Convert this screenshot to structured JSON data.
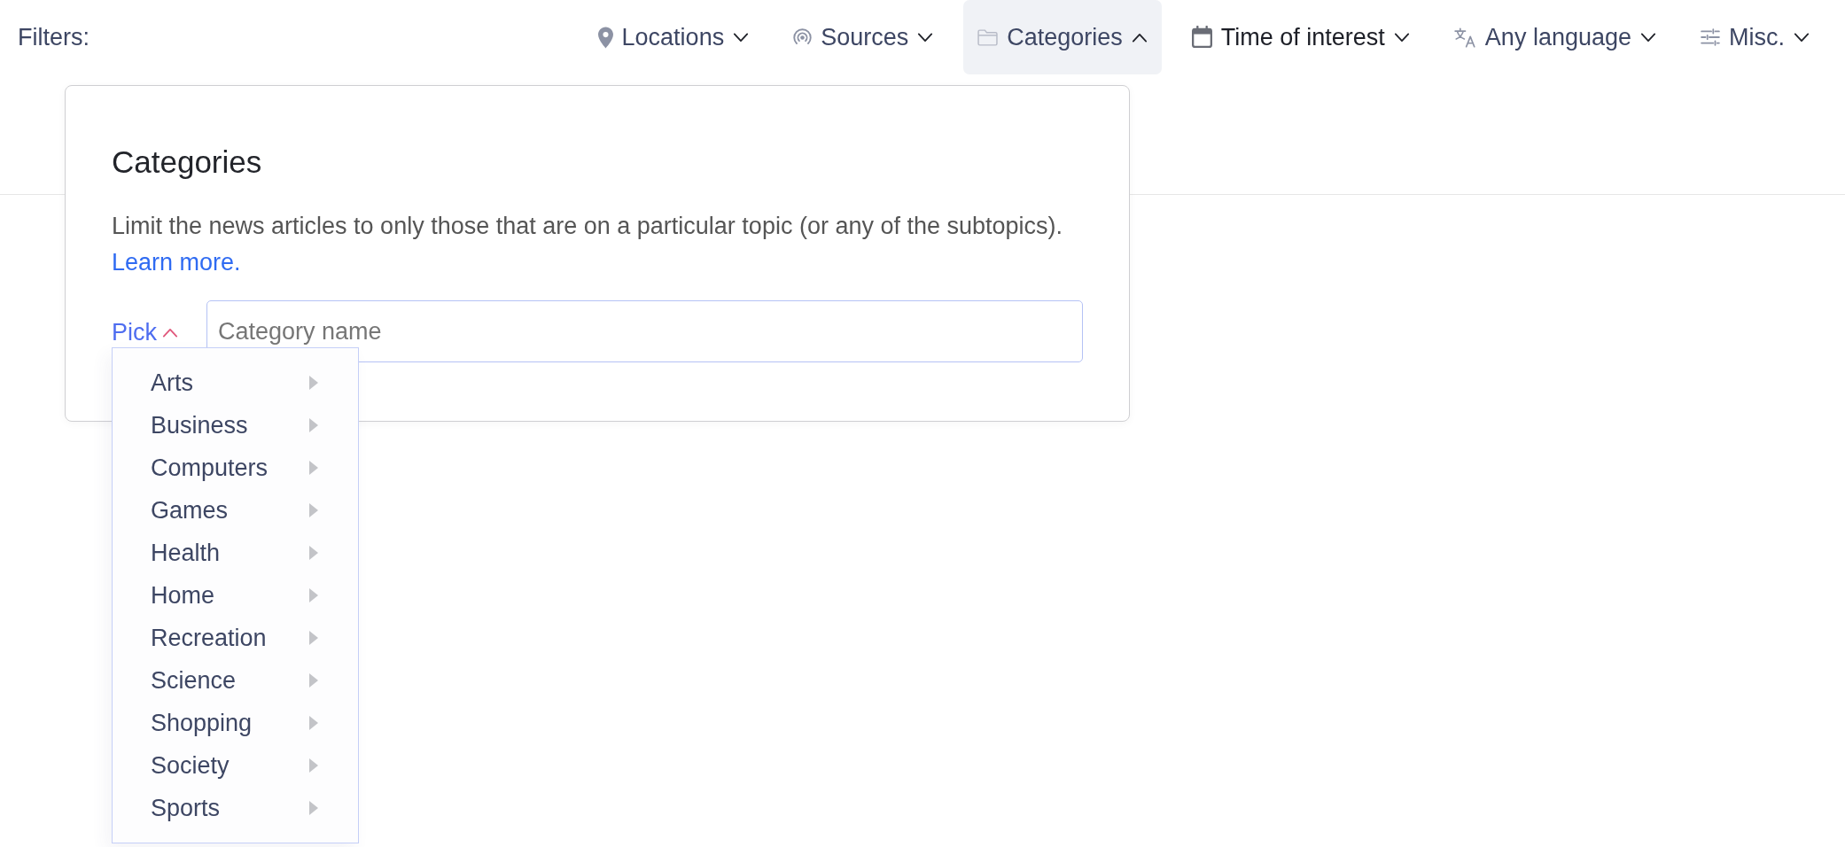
{
  "filter_bar": {
    "label": "Filters:",
    "filters": [
      {
        "kind": "location",
        "label": "Locations",
        "expanded": false,
        "active": false
      },
      {
        "kind": "source",
        "label": "Sources",
        "expanded": false,
        "active": false
      },
      {
        "kind": "category",
        "label": "Categories",
        "expanded": true,
        "active": false
      },
      {
        "kind": "time",
        "label": "Time of interest",
        "expanded": false,
        "active": true
      },
      {
        "kind": "language",
        "label": "Any language",
        "expanded": false,
        "active": false
      },
      {
        "kind": "misc",
        "label": "Misc.",
        "expanded": false,
        "active": false
      }
    ]
  },
  "categories_popover": {
    "title": "Categories",
    "description": "Limit the news articles to only those that are on a particular topic (or any of the subtopics).",
    "link": "Learn more.",
    "picker": {
      "label": "Pick",
      "expanded": true
    },
    "search": {
      "placeholder": "Category name"
    },
    "menu": {
      "items": [
        {
          "label": "Arts",
          "has_submenu": true
        },
        {
          "label": "Business",
          "has_submenu": true
        },
        {
          "label": "Computers",
          "has_submenu": true
        },
        {
          "label": "Games",
          "has_submenu": true
        },
        {
          "label": "Health",
          "has_submenu": true
        },
        {
          "label": "Home",
          "has_submenu": true
        },
        {
          "label": "Recreation",
          "has_submenu": true
        },
        {
          "label": "Science",
          "has_submenu": true
        },
        {
          "label": "Shopping",
          "has_submenu": true
        },
        {
          "label": "Society",
          "has_submenu": true
        },
        {
          "label": "Sports",
          "has_submenu": true
        }
      ]
    }
  }
}
